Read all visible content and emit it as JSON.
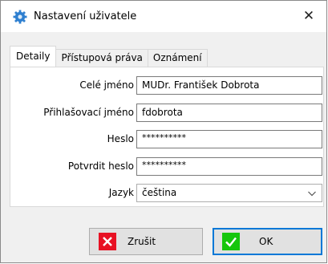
{
  "window": {
    "title": "Nastavení uživatele",
    "icon": "gear-icon",
    "close": "✕"
  },
  "tabs": [
    {
      "label": "Detaily",
      "active": true
    },
    {
      "label": "Přístupová práva",
      "active": false
    },
    {
      "label": "Oznámení",
      "active": false
    }
  ],
  "form": {
    "full_name_label": "Celé jméno",
    "full_name_value": "MUDr. František Dobrota",
    "login_label": "Přihlašovací jméno",
    "login_value": "fdobrota",
    "password_label": "Heslo",
    "password_value": "**********",
    "confirm_label": "Potvrdit heslo",
    "confirm_value": "**********",
    "language_label": "Jazyk",
    "language_value": "čeština"
  },
  "buttons": {
    "cancel_label": "Zrušit",
    "ok_label": "OK"
  },
  "colors": {
    "accent": "#0078d7",
    "cancel_icon": "#e81123",
    "ok_icon": "#16c60c"
  }
}
